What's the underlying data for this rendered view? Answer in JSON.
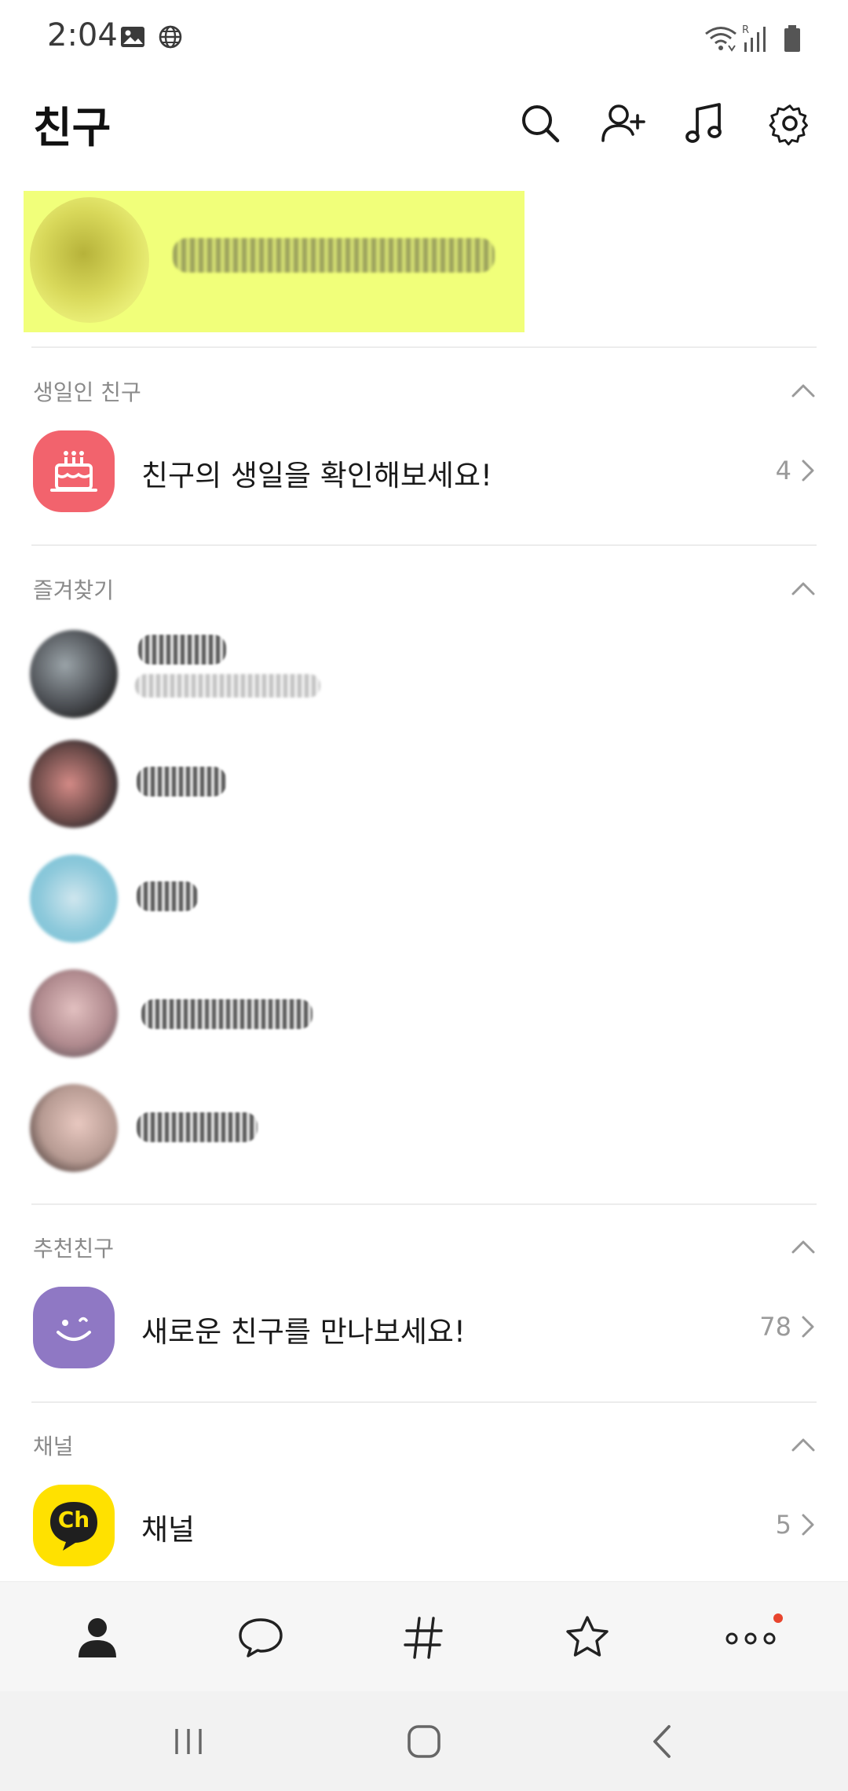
{
  "status_bar": {
    "time": "2:04",
    "left_icons": [
      "image-icon",
      "globe-icon"
    ],
    "right_icons": [
      "wifi-icon",
      "signal-icon",
      "battery-icon"
    ]
  },
  "header": {
    "title": "친구",
    "actions": [
      "search-icon",
      "add-friend-icon",
      "music-icon",
      "settings-icon"
    ]
  },
  "profile": {
    "highlight_color": "#f1ff7a"
  },
  "sections": {
    "birthday": {
      "title": "생일인 친구",
      "row_label": "친구의 생일을 확인해보세요!",
      "count": "4",
      "icon": "cake-icon",
      "icon_color": "#f2636d"
    },
    "favorites": {
      "title": "즐겨찾기"
    },
    "recommended": {
      "title": "추천친구",
      "row_label": "새로운 친구를 만나보세요!",
      "count": "78",
      "icon": "smile-icon",
      "icon_color": "#8f78c4"
    },
    "channel": {
      "title": "채널",
      "row_label": "채널",
      "count": "5",
      "icon": "channel-icon",
      "icon_text": "Ch",
      "icon_color": "#ffe100"
    }
  },
  "bottom_nav": {
    "items": [
      "friends-tab-icon",
      "chat-tab-icon",
      "hashtag-tab-icon",
      "star-tab-icon",
      "more-tab-icon"
    ],
    "notification_dot_color": "#e8452e"
  },
  "system_nav": [
    "recents-icon",
    "home-icon",
    "back-icon"
  ]
}
